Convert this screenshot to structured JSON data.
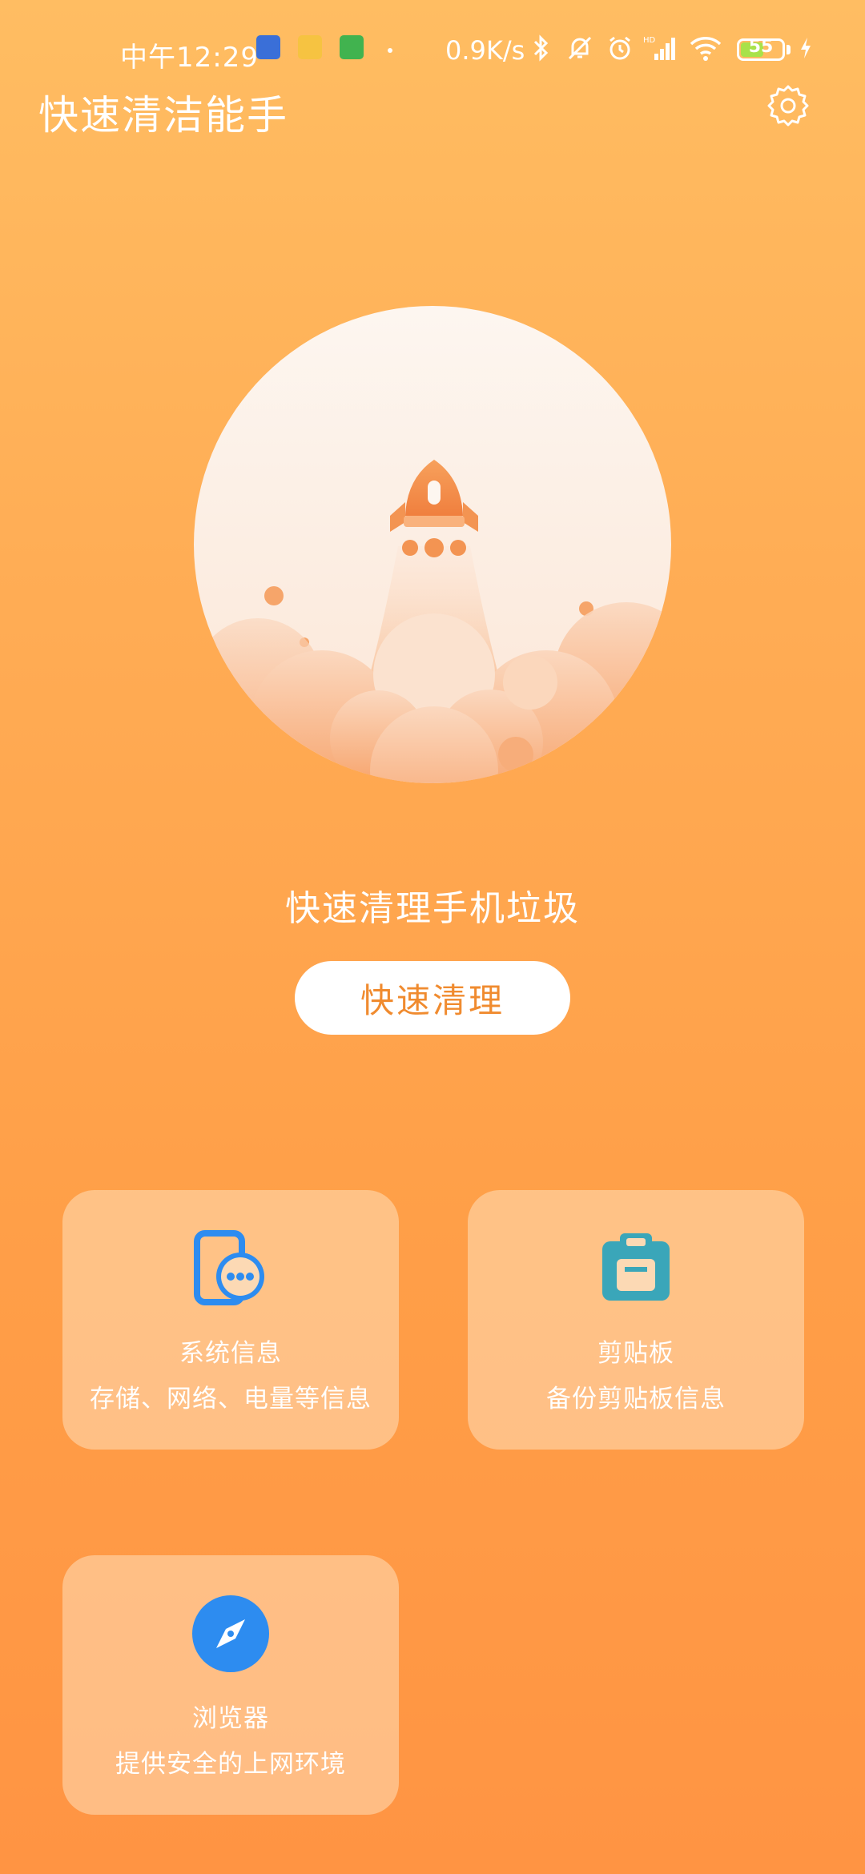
{
  "status_bar": {
    "time": "中午12:29",
    "net_speed": "0.9K/s",
    "battery": "55",
    "battery_level": 0.55
  },
  "header": {
    "title": "快速清洁能手",
    "settings_icon": "gear-icon"
  },
  "hero": {
    "illustration": "rocket-launch",
    "label": "快速清理手机垃圾",
    "button_label": "快速清理"
  },
  "cards": [
    {
      "icon": "phone-chat-icon",
      "title": "系统信息",
      "desc": "存储、网络、电量等信息"
    },
    {
      "icon": "clipboard-icon",
      "title": "剪贴板",
      "desc": "备份剪贴板信息"
    },
    {
      "icon": "compass-icon",
      "title": "浏览器",
      "desc": "提供安全的上网环境"
    }
  ],
  "colors": {
    "bg_top": "#ffbd62",
    "bg_bottom": "#ff9443",
    "accent": "#f08b2f",
    "icon_blue": "#2d8cf0",
    "icon_teal": "#3aa6b9"
  }
}
